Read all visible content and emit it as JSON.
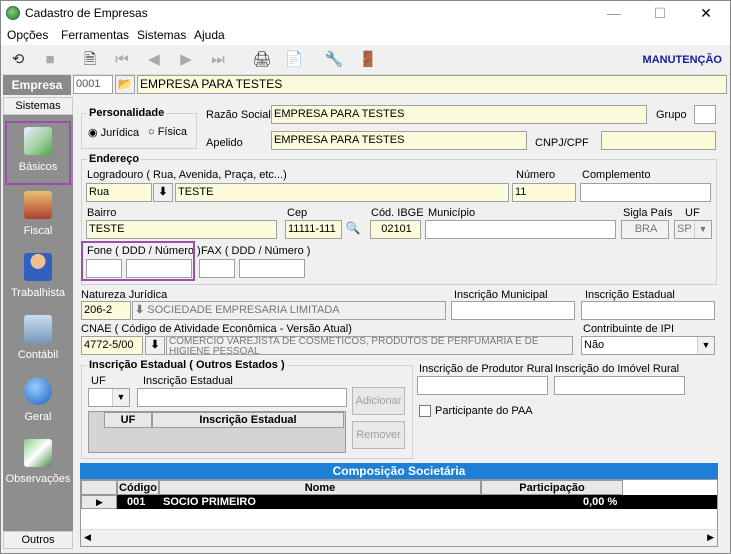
{
  "window": {
    "title": "Cadastro de Empresas"
  },
  "menu": [
    "Opções",
    "Ferramentas",
    "Sistemas",
    "Ajuda"
  ],
  "toolbar": {
    "mode": "MANUTENÇÃO"
  },
  "empresa": {
    "label": "Empresa",
    "code": "0001",
    "name": "EMPRESA PARA TESTES"
  },
  "sidebar": {
    "header": "Sistemas",
    "items": [
      "Básicos",
      "Fiscal",
      "Trabalhista",
      "Contábil",
      "Geral",
      "Observações"
    ],
    "footer": "Outros"
  },
  "personalidade": {
    "title": "Personalidade",
    "options": [
      "Jurídica",
      "Física"
    ],
    "selected": "Jurídica"
  },
  "razao": {
    "label": "Razão Social",
    "value": "EMPRESA PARA TESTES"
  },
  "grupo": {
    "label": "Grupo",
    "value": ""
  },
  "apelido": {
    "label": "Apelido",
    "value": "EMPRESA PARA TESTES"
  },
  "cnpj": {
    "label": "CNPJ/CPF",
    "value": ""
  },
  "endereco": {
    "title": "Endereço",
    "logradouro_label": "Logradouro ( Rua, Avenida, Praça, etc...)",
    "tipo": "Rua",
    "logradouro": "TESTE",
    "numero_label": "Número",
    "numero": "11",
    "complemento_label": "Complemento",
    "complemento": "",
    "bairro_label": "Bairro",
    "bairro": "TESTE",
    "cep_label": "Cep",
    "cep": "11111-111",
    "ibge_label": "Cód. IBGE",
    "ibge": "02101",
    "municipio_label": "Município",
    "municipio": "",
    "pais_label": "Sigla País",
    "pais": "BRA",
    "uf_label": "UF",
    "uf": "SP",
    "fone_label": "Fone ( DDD / Número )",
    "fax_label": "FAX ( DDD / Número )"
  },
  "natureza": {
    "label": "Natureza Jurídica",
    "code": "206-2",
    "desc": "SOCIEDADE EMPRESARIA LIMITADA"
  },
  "insc_municipal": {
    "label": "Inscrição Municipal",
    "value": ""
  },
  "insc_estadual": {
    "label": "Inscrição Estadual",
    "value": ""
  },
  "cnae": {
    "label": "CNAE ( Código de Atividade Econômica - Versão Atual)",
    "code": "4772-5/00",
    "desc": "COMÉRCIO VAREJISTA DE COSMÉTICOS, PRODUTOS DE PERFUMARIA E DE HIGIENE PESSOAL"
  },
  "ipi": {
    "label": "Contribuinte de IPI",
    "value": "Não"
  },
  "outros_estados": {
    "title": "Inscrição Estadual ( Outros Estados )",
    "uf_label": "UF",
    "ie_label": "Inscrição Estadual",
    "col_uf": "UF",
    "col_ie": "Inscrição Estadual",
    "add": "Adicionar",
    "remove": "Remover"
  },
  "rural": {
    "produtor_label": "Inscrição de Produtor Rural",
    "imovel_label": "Inscrição do Imóvel Rural",
    "paa_label": "Participante do PAA"
  },
  "composicao": {
    "title": "Composição Societária",
    "cols": [
      "Código",
      "Nome",
      "Participação"
    ],
    "rows": [
      {
        "codigo": "001",
        "nome": "SOCIO PRIMEIRO",
        "participacao": "0,00 %"
      }
    ]
  },
  "colors": {
    "accent": "#1e7fd6",
    "highlight": "#9b4fa8",
    "title_blue": "#1a1a9c"
  }
}
